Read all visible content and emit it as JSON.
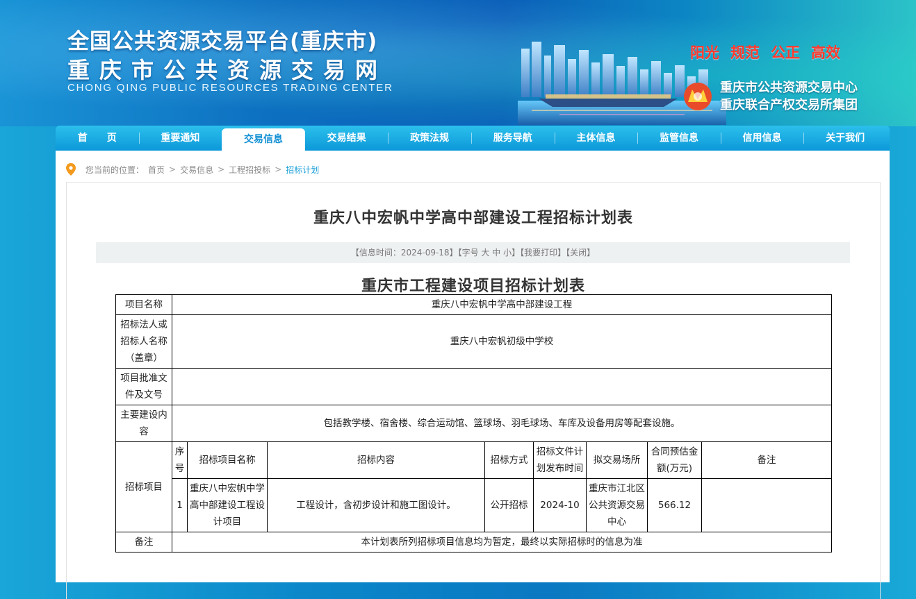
{
  "header": {
    "title_line1": "全国公共资源交易平台(重庆市)",
    "title_line2": "重庆市公共资源交易网",
    "title_en": "CHONG QING PUBLIC RESOURCES TRADING CENTER",
    "slogans": [
      "阳光",
      "规范",
      "公正",
      "高效"
    ],
    "org_line1": "重庆市公共资源交易中心",
    "org_line2": "重庆联合产权交易所集团",
    "colors": {
      "slogan": "#ff3a2e",
      "nav": "#0c98d9"
    }
  },
  "nav": {
    "items": [
      "首　　页",
      "重要通知",
      "交易信息",
      "交易结果",
      "政策法规",
      "服务导航",
      "主体信息",
      "监管信息",
      "信用信息",
      "关于我们"
    ],
    "active_index": 2
  },
  "breadcrumb": {
    "prefix": "您当前的位置：",
    "items": [
      "首页",
      "交易信息",
      "工程招投标",
      "招标计划"
    ]
  },
  "article": {
    "title": "重庆八中宏帆中学高中部建设工程招标计划表",
    "info": {
      "time_label": "【信息时间：2024-09-18】",
      "font_label": "【字号",
      "font_large": "大",
      "font_medium": "中",
      "font_small": "小",
      "font_end": "】",
      "print": "【我要打印】",
      "close": "【关闭】"
    },
    "table_title": "重庆市工程建设项目招标计划表",
    "table": {
      "project_name_label": "项目名称",
      "project_name": "重庆八中宏帆中学高中部建设工程",
      "tenderer_label": "招标法人或招标人名称（盖章）",
      "tenderer": "重庆八中宏帆初级中学校",
      "approval_label": "项目批准文件及文号",
      "approval": "",
      "scope_label": "主要建设内容",
      "scope": "包括教学楼、宿舍楼、综合运动馆、篮球场、羽毛球场、车库及设备用房等配套设施。",
      "items_label": "招标项目",
      "headers": [
        "序号",
        "招标项目名称",
        "招标内容",
        "招标方式",
        "招标文件计划发布时间",
        "拟交易场所",
        "合同预估金额(万元)",
        "备注"
      ],
      "rows": [
        {
          "no": "1",
          "name": "重庆八中宏帆中学高中部建设工程设计项目",
          "content": "工程设计，含初步设计和施工图设计。",
          "method": "公开招标",
          "publish_time": "2024-10",
          "venue": "重庆市江北区公共资源交易中心",
          "amount": "566.12",
          "remark": ""
        }
      ],
      "note_label": "备注",
      "note": "本计划表所列招标项目信息均为暂定，最终以实际招标时的信息为准"
    }
  }
}
